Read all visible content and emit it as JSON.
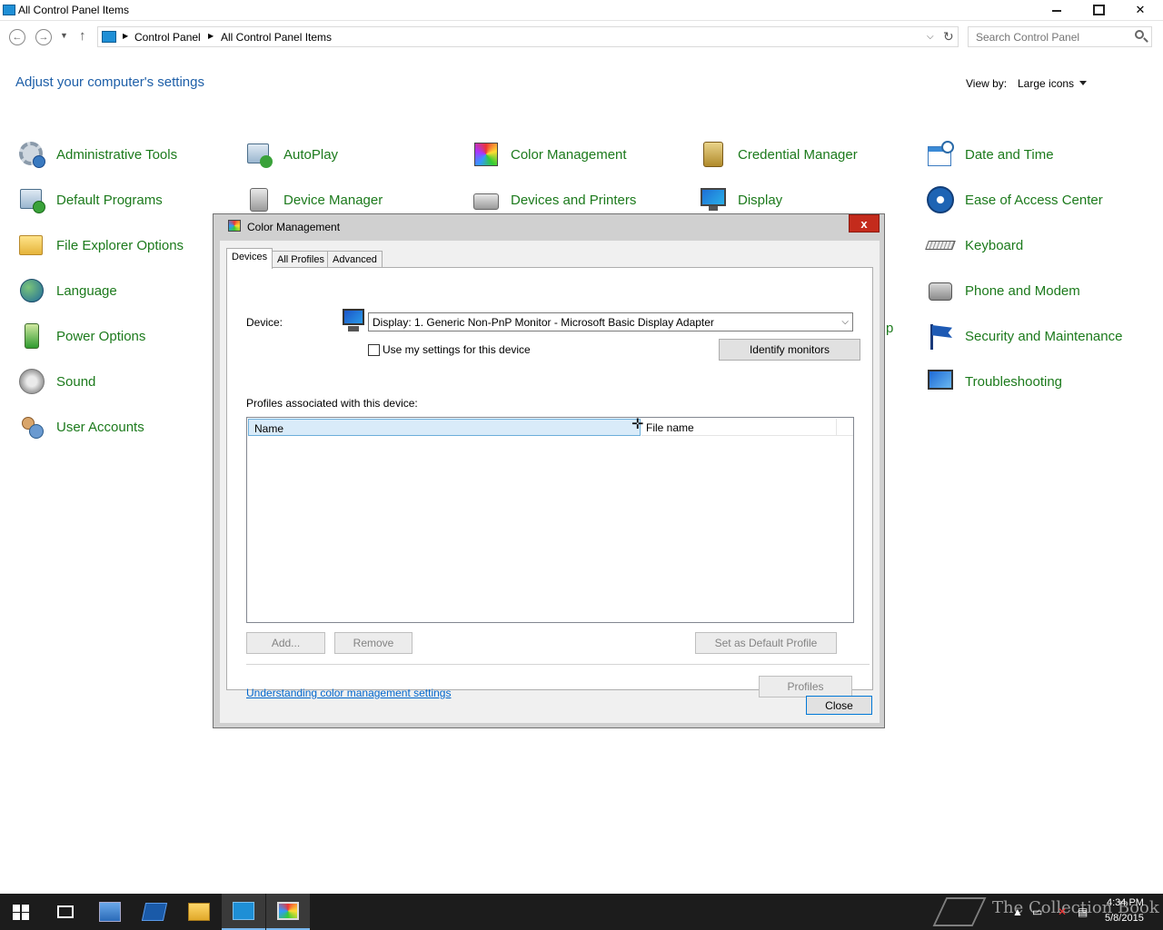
{
  "window": {
    "title": "All Control Panel Items"
  },
  "address": {
    "crumbs": [
      "Control Panel",
      "All Control Panel Items"
    ],
    "search_placeholder": "Search Control Panel"
  },
  "main": {
    "heading": "Adjust your computer's settings",
    "view_by_label": "View by:",
    "view_by_value": "Large icons",
    "peek_fragment": "p"
  },
  "items": [
    {
      "label": "Administrative Tools",
      "icon": "administrative-tools-icon"
    },
    {
      "label": "AutoPlay",
      "icon": "autoplay-icon"
    },
    {
      "label": "Color Management",
      "icon": "color-management-icon"
    },
    {
      "label": "Credential Manager",
      "icon": "credential-manager-icon"
    },
    {
      "label": "Date and Time",
      "icon": "date-time-icon"
    },
    {
      "label": "Default Programs",
      "icon": "default-programs-icon"
    },
    {
      "label": "Device Manager",
      "icon": "device-manager-icon"
    },
    {
      "label": "Devices and Printers",
      "icon": "printer-icon"
    },
    {
      "label": "Display",
      "icon": "display-icon"
    },
    {
      "label": "Ease of Access Center",
      "icon": "ease-of-access-icon"
    },
    {
      "label": "File Explorer Options",
      "icon": "folder-icon"
    },
    {
      "label": "Keyboard",
      "icon": "keyboard-icon"
    },
    {
      "label": "Language",
      "icon": "language-icon"
    },
    {
      "label": "Phone and Modem",
      "icon": "phone-icon"
    },
    {
      "label": "Power Options",
      "icon": "battery-icon"
    },
    {
      "label": "Security and Maintenance",
      "icon": "flag-icon"
    },
    {
      "label": "Sound",
      "icon": "speaker-icon"
    },
    {
      "label": "Troubleshooting",
      "icon": "troubleshooting-icon"
    },
    {
      "label": "User Accounts",
      "icon": "users-icon"
    }
  ],
  "dialog": {
    "title": "Color Management",
    "close_glyph": "x",
    "tabs": [
      "Devices",
      "All Profiles",
      "Advanced"
    ],
    "device_label": "Device:",
    "device_value": "Display: 1. Generic Non-PnP Monitor - Microsoft Basic Display Adapter",
    "use_settings_label": "Use my settings for this device",
    "identify_button": "Identify monitors",
    "profiles_label": "Profiles associated with this device:",
    "columns": [
      "Name",
      "File name"
    ],
    "add_button": "Add...",
    "remove_button": "Remove",
    "set_default_button": "Set as Default Profile",
    "link": "Understanding color management settings",
    "profiles_button": "Profiles",
    "close_button": "Close"
  },
  "taskbar": {
    "watermark": "The Collection Book",
    "time": "4:34 PM",
    "date": "5/8/2015"
  }
}
